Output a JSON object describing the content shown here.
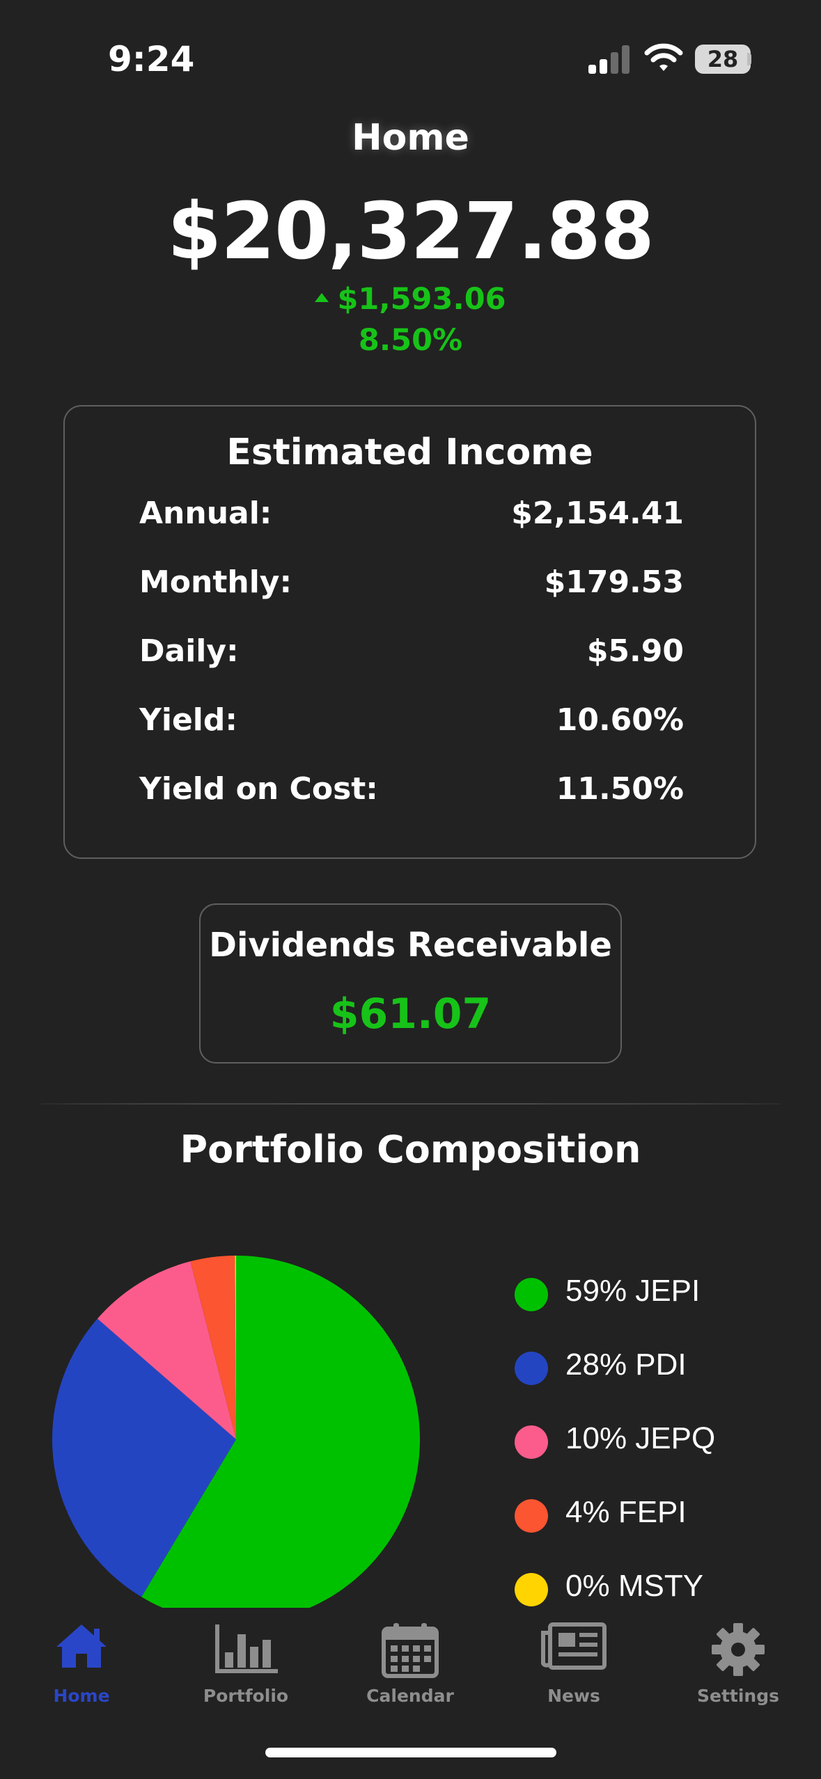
{
  "status_bar": {
    "time": "9:24",
    "battery": "28"
  },
  "header": {
    "title": "Home",
    "total_value": "$20,327.88",
    "change_amount": "$1,593.06",
    "change_percent": "8.50%"
  },
  "estimated_income": {
    "title": "Estimated Income",
    "rows": [
      {
        "label": "Annual:",
        "value": "$2,154.41"
      },
      {
        "label": "Monthly:",
        "value": "$179.53"
      },
      {
        "label": "Daily:",
        "value": "$5.90"
      },
      {
        "label": "Yield:",
        "value": "10.60%"
      },
      {
        "label": "Yield on Cost:",
        "value": "11.50%"
      }
    ]
  },
  "dividends_receivable": {
    "title": "Dividends Receivable",
    "value": "$61.07"
  },
  "composition": {
    "title": "Portfolio Composition"
  },
  "chart_data": {
    "type": "pie",
    "categories": [
      "JEPI",
      "PDI",
      "JEPQ",
      "FEPI",
      "MSTY"
    ],
    "values": [
      58.6,
      27.8,
      9.6,
      3.9,
      0.1
    ],
    "legend_labels": [
      "59% JEPI",
      "28% PDI",
      "10% JEPQ",
      "4% FEPI",
      "0% MSTY"
    ],
    "colors": [
      "#00c100",
      "#2445c2",
      "#fc5c8c",
      "#fb5532",
      "#ffd400"
    ],
    "legend": "right"
  },
  "tabbar": {
    "active_color": "#2a46c8",
    "inactive_color": "#8e8e8e",
    "items": [
      {
        "label": "Home",
        "icon": "house-icon"
      },
      {
        "label": "Portfolio",
        "icon": "bar-chart-icon"
      },
      {
        "label": "Calendar",
        "icon": "calendar-icon"
      },
      {
        "label": "News",
        "icon": "newspaper-icon"
      },
      {
        "label": "Settings",
        "icon": "gear-icon"
      }
    ]
  }
}
